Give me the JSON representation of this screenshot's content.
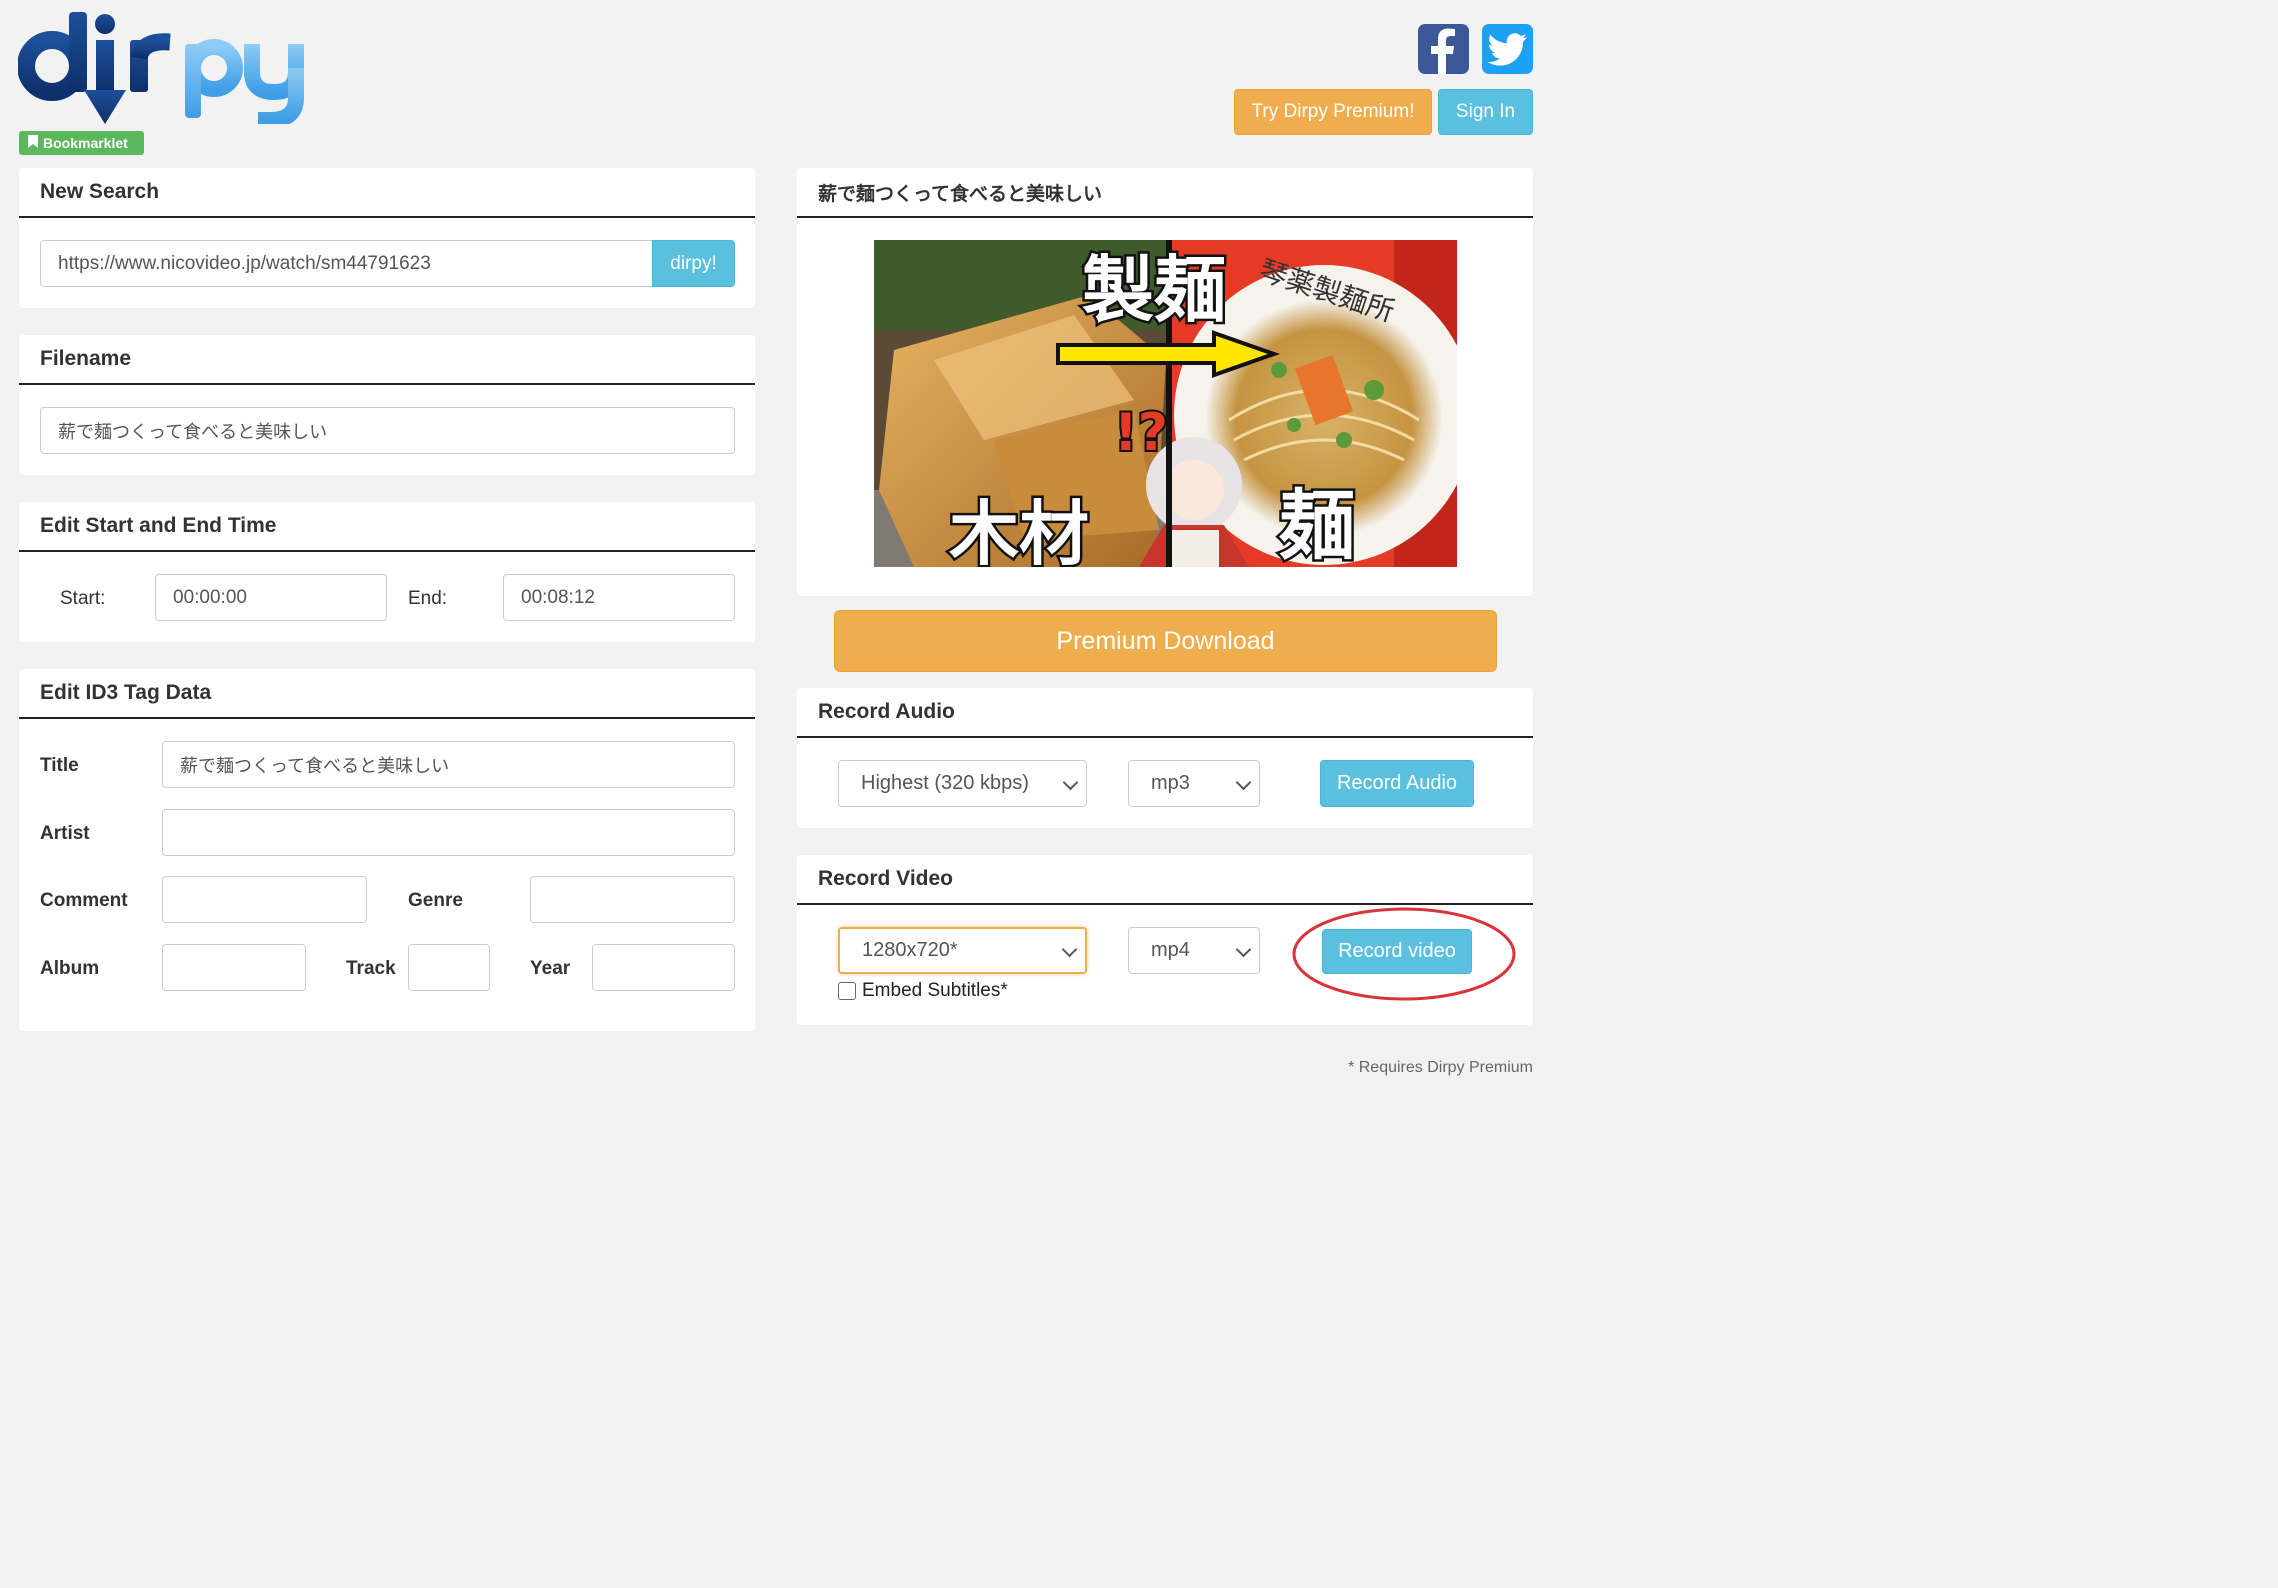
{
  "logo": {
    "text": "dirpy"
  },
  "bookmarklet": {
    "label": "Bookmarklet"
  },
  "header": {
    "premium_label": "Try Dirpy Premium!",
    "signin_label": "Sign In",
    "social": [
      "facebook-icon",
      "twitter-icon"
    ]
  },
  "new_search": {
    "title": "New Search",
    "url": "https://www.nicovideo.jp/watch/sm44791623",
    "submit_label": "dirpy!"
  },
  "filename": {
    "title": "Filename",
    "value": "薪で麺つくって食べると美味しい"
  },
  "time": {
    "title": "Edit Start and End Time",
    "start_label": "Start:",
    "start_value": "00:00:00",
    "end_label": "End:",
    "end_value": "00:08:12"
  },
  "id3": {
    "title": "Edit ID3 Tag Data",
    "title_label": "Title",
    "title_value": "薪で麺つくって食べると美味しい",
    "artist_label": "Artist",
    "comment_label": "Comment",
    "genre_label": "Genre",
    "album_label": "Album",
    "track_label": "Track",
    "year_label": "Year"
  },
  "video": {
    "title": "薪で麺つくって食べると美味しい",
    "thumb_text_top": "製麺",
    "thumb_text_left": "木材",
    "thumb_text_right": "麺",
    "thumb_text_mark": "!?",
    "thumb_text_bowl": "琴薬製麺所"
  },
  "premium_download": {
    "label": "Premium Download"
  },
  "record_audio": {
    "title": "Record Audio",
    "quality": "Highest (320 kbps)",
    "format": "mp3",
    "button_label": "Record Audio"
  },
  "record_video": {
    "title": "Record Video",
    "resolution": "1280x720*",
    "format": "mp4",
    "button_label": "Record video",
    "subtitles_label": "Embed Subtitles*"
  },
  "footnote": "* Requires Dirpy Premium",
  "colors": {
    "orange": "#f0ad4e",
    "blue": "#5bc0de",
    "green": "#5cb85c",
    "annotation": "#d9343b"
  }
}
